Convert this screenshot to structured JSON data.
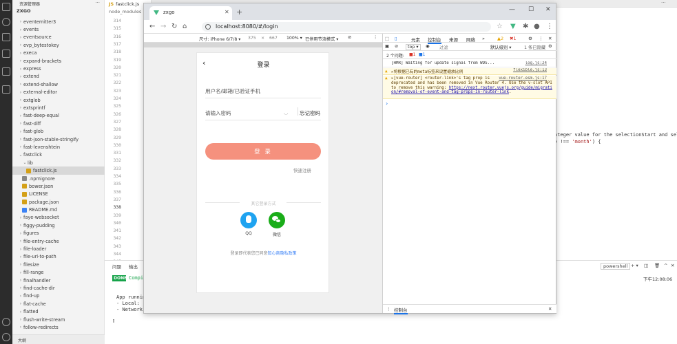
{
  "vscode": {
    "explorer_title": "资源管理器",
    "project": "ZXGO",
    "tree": [
      {
        "label": "eventemitter3",
        "kind": "folder"
      },
      {
        "label": "events",
        "kind": "folder"
      },
      {
        "label": "eventsource",
        "kind": "folder"
      },
      {
        "label": "evp_bytestokey",
        "kind": "folder"
      },
      {
        "label": "execa",
        "kind": "folder"
      },
      {
        "label": "expand-brackets",
        "kind": "folder"
      },
      {
        "label": "express",
        "kind": "folder"
      },
      {
        "label": "extend",
        "kind": "folder"
      },
      {
        "label": "extend-shallow",
        "kind": "folder"
      },
      {
        "label": "external-editor",
        "kind": "folder"
      },
      {
        "label": "extglob",
        "kind": "folder"
      },
      {
        "label": "extsprintf",
        "kind": "folder"
      },
      {
        "label": "fast-deep-equal",
        "kind": "folder"
      },
      {
        "label": "fast-diff",
        "kind": "folder"
      },
      {
        "label": "fast-glob",
        "kind": "folder"
      },
      {
        "label": "fast-json-stable-stringify",
        "kind": "folder"
      },
      {
        "label": "fast-levenshtein",
        "kind": "folder"
      },
      {
        "label": "fastclick",
        "kind": "folder-open"
      },
      {
        "label": "lib",
        "kind": "folder-open"
      },
      {
        "label": "fastclick.js",
        "kind": "js"
      },
      {
        "label": ".npmignore",
        "kind": "file"
      },
      {
        "label": "bower.json",
        "kind": "json"
      },
      {
        "label": "LICENSE",
        "kind": "license"
      },
      {
        "label": "package.json",
        "kind": "json"
      },
      {
        "label": "README.md",
        "kind": "md"
      },
      {
        "label": "faye-websocket",
        "kind": "folder"
      },
      {
        "label": "figgy-pudding",
        "kind": "folder"
      },
      {
        "label": "figures",
        "kind": "folder"
      },
      {
        "label": "file-entry-cache",
        "kind": "folder"
      },
      {
        "label": "file-loader",
        "kind": "folder"
      },
      {
        "label": "file-uri-to-path",
        "kind": "folder"
      },
      {
        "label": "filesize",
        "kind": "folder"
      },
      {
        "label": "fill-range",
        "kind": "folder"
      },
      {
        "label": "finalhandler",
        "kind": "folder"
      },
      {
        "label": "find-cache-dir",
        "kind": "folder"
      },
      {
        "label": "find-up",
        "kind": "folder"
      },
      {
        "label": "flat-cache",
        "kind": "folder"
      },
      {
        "label": "flatted",
        "kind": "folder"
      },
      {
        "label": "flush-write-stream",
        "kind": "folder"
      },
      {
        "label": "follow-redirects",
        "kind": "folder"
      }
    ],
    "outline_label": "大纲",
    "tab_label": "fastclick.js",
    "breadcrumb": "node_modules",
    "line_numbers": [
      "314",
      "315",
      "316",
      "317",
      "318",
      "319",
      "320",
      "321",
      "322",
      "323",
      "324",
      "325",
      "326",
      "327",
      "328",
      "329",
      "330",
      "331",
      "332",
      "333",
      "334",
      "335",
      "336",
      "337",
      "338",
      "339",
      "340",
      "341",
      "342",
      "343",
      "344",
      "345",
      "346",
      "347"
    ],
    "code_right_1": "nteger value for the selectionStart and sele",
    "code_right_2": "e !== 'month') {",
    "terminal": {
      "tab_problems": "问题",
      "tab_output": "输出",
      "shell": "powershell",
      "done": "DONE",
      "compiled": "Compil",
      "time": "下午12:08:06",
      "lines": [
        "App running",
        "- Local:",
        "- Network:"
      ]
    }
  },
  "chrome": {
    "tab_title": "zxgo",
    "url": "localhost:8080/#/login",
    "device": "尺寸: iPhone 6/7/8 ▾",
    "width": "375",
    "height": "667",
    "zoom": "100% ▾",
    "throttle": "已停用节流模式 ▾",
    "page": {
      "title": "登录",
      "username_placeholder": "用户名/邮箱/已验证手机",
      "password_placeholder": "请输入密码",
      "forgot": "忘记密码",
      "login_button": "登 录",
      "signup": "快速注册",
      "other_login": "其它登录方式",
      "qq": "QQ",
      "wechat": "微信",
      "agree_prefix": "登录即代表您已同意",
      "agree_link": "知心商隐私政策"
    },
    "devtools": {
      "tabs": [
        "元素",
        "控制台",
        "来源",
        "网络"
      ],
      "active_tab": "控制台",
      "more": "»",
      "warn_count": "2",
      "err_count": "1",
      "context": "top",
      "filter_placeholder": "过滤",
      "level": "默认级别 ▾",
      "hidden": "1 条已隐藏",
      "issues_label": "2 个问题:",
      "issues_err": "1",
      "issues_info": "1",
      "console": [
        {
          "text": "[HMR] Waiting for update signal from WDS...",
          "src": "log.js:24",
          "kind": "log"
        },
        {
          "text": "▸将根据已有的meta标签来设置缩放比例",
          "src": "flexible.js:13",
          "kind": "warn"
        },
        {
          "text": "▸[vue-router] <router-link>'s tag prop is",
          "src": "vue-router.esm.js:17",
          "kind": "warn"
        },
        {
          "text": "deprecated and has been removed in Vue Router 4. Use the v-slot API",
          "kind": "warn-cont"
        },
        {
          "text": "to remove this warning: ",
          "link": "https://next.router.vuejs.org/guide/migrati",
          "kind": "warn-cont"
        },
        {
          "text": "",
          "link": "on/#removal-of-event-and-tag-props-in-router-link",
          "tail": ".",
          "kind": "warn-cont"
        }
      ],
      "prompt": "›",
      "drawer_label": "控制台"
    }
  },
  "colors": {
    "login_button": "#f5917e",
    "qq": "#1fa3f0",
    "wechat": "#1aad19",
    "done_badge": "#16a34a"
  }
}
